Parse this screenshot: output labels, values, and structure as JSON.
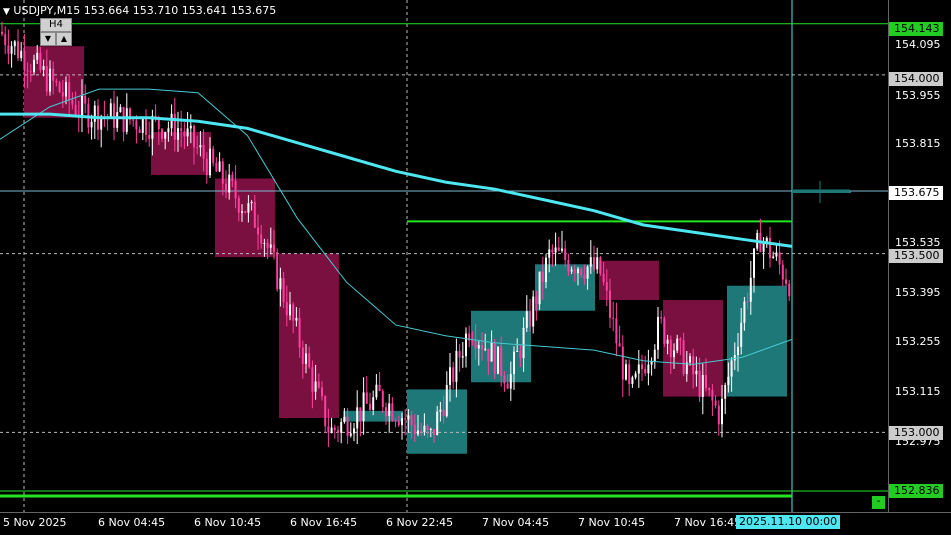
{
  "header": {
    "title": "USDJPY,M15  153.664 153.710 153.641 153.675",
    "timeframe_button": "H4",
    "nav_down_icon": "▼",
    "nav_up_icon": "▲"
  },
  "price_axis": {
    "ticks": [
      "154.095",
      "153.955",
      "153.815",
      "153.535",
      "153.395",
      "153.255",
      "153.115",
      "152.975"
    ],
    "tags": [
      {
        "label": "154.143",
        "bg": "#22cc22",
        "fg": "#000000"
      },
      {
        "label": "154.000",
        "bg": "#cccccc",
        "fg": "#000000"
      },
      {
        "label": "153.675",
        "bg": "#ffffff",
        "fg": "#000000"
      },
      {
        "label": "153.500",
        "bg": "#cccccc",
        "fg": "#000000"
      },
      {
        "label": "153.000",
        "bg": "#cccccc",
        "fg": "#000000"
      },
      {
        "label": "152.836",
        "bg": "#22cc22",
        "fg": "#000000"
      }
    ]
  },
  "time_axis": {
    "ticks": [
      "5 Nov 2025",
      "6 Nov 04:45",
      "6 Nov 10:45",
      "6 Nov 16:45",
      "6 Nov 22:45",
      "7 Nov 04:45",
      "7 Nov 10:45",
      "7 Nov 16:45"
    ],
    "cursor_label": "2025.11.10 00:00"
  },
  "controls": {
    "minus_label": "-"
  },
  "colors": {
    "bull": "#ffffff",
    "bear": "#ff3fa0",
    "bull_box": "#1e7878",
    "bear_box": "#7a1040",
    "ma_slow": "#4ee6f0",
    "ma_fast": "#48c8d0",
    "level_green": "#22e622",
    "grid_dash": "#bbbbbb"
  },
  "chart_data": {
    "type": "candlestick",
    "symbol": "USDJPY",
    "timeframe": "M15",
    "last_close": 153.675,
    "y_range": [
      152.8,
      154.2
    ],
    "levels": [
      {
        "price": 154.143,
        "style": "solid-green"
      },
      {
        "price": 154.0,
        "style": "dashed"
      },
      {
        "price": 153.675,
        "style": "current"
      },
      {
        "price": 153.5,
        "style": "dashed"
      },
      {
        "price": 153.0,
        "style": "dashed"
      },
      {
        "price": 152.836,
        "style": "solid-green"
      }
    ],
    "h4_boxes": [
      {
        "open": 154.08,
        "close": 153.88,
        "dir": "bear"
      },
      {
        "open": 153.84,
        "close": 153.72,
        "dir": "bear"
      },
      {
        "open": 153.71,
        "close": 153.49,
        "dir": "bear"
      },
      {
        "open": 153.5,
        "close": 153.04,
        "dir": "bear"
      },
      {
        "open": 153.03,
        "close": 153.06,
        "dir": "bull"
      },
      {
        "open": 152.94,
        "close": 153.12,
        "dir": "bull"
      },
      {
        "open": 153.14,
        "close": 153.34,
        "dir": "bull"
      },
      {
        "open": 153.34,
        "close": 153.47,
        "dir": "bull"
      },
      {
        "open": 153.48,
        "close": 153.37,
        "dir": "bear"
      },
      {
        "open": 153.37,
        "close": 153.1,
        "dir": "bear"
      },
      {
        "open": 153.1,
        "close": 153.41,
        "dir": "bull"
      },
      {
        "open": 153.675,
        "close": 153.675,
        "dir": "bull"
      }
    ],
    "ma_slow": [
      153.89,
      153.89,
      153.88,
      153.88,
      153.87,
      153.85,
      153.81,
      153.77,
      153.73,
      153.7,
      153.68,
      153.65,
      153.62,
      153.58,
      153.56,
      153.54,
      153.52
    ],
    "ma_fast": [
      153.82,
      153.91,
      153.96,
      153.96,
      153.95,
      153.83,
      153.6,
      153.42,
      153.3,
      153.27,
      153.25,
      153.24,
      153.23,
      153.2,
      153.19,
      153.21,
      153.26
    ],
    "trend_segment": [
      {
        "price": 153.59
      },
      {
        "price": 153.59
      }
    ]
  }
}
